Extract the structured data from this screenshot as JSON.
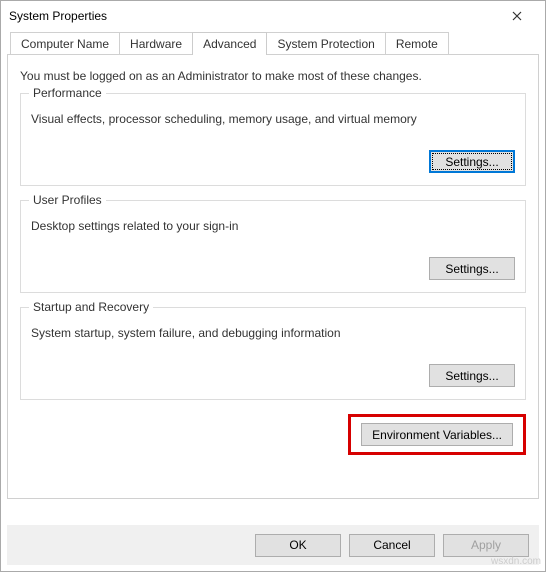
{
  "window": {
    "title": "System Properties"
  },
  "tabs": {
    "computer_name": "Computer Name",
    "hardware": "Hardware",
    "advanced": "Advanced",
    "system_protection": "System Protection",
    "remote": "Remote"
  },
  "advanced_panel": {
    "lead": "You must be logged on as an Administrator to make most of these changes.",
    "performance": {
      "legend": "Performance",
      "desc": "Visual effects, processor scheduling, memory usage, and virtual memory",
      "settings": "Settings..."
    },
    "user_profiles": {
      "legend": "User Profiles",
      "desc": "Desktop settings related to your sign-in",
      "settings": "Settings..."
    },
    "startup_recovery": {
      "legend": "Startup and Recovery",
      "desc": "System startup, system failure, and debugging information",
      "settings": "Settings..."
    },
    "env_vars": "Environment Variables..."
  },
  "footer": {
    "ok": "OK",
    "cancel": "Cancel",
    "apply": "Apply"
  },
  "watermark": "wsxdn.com"
}
